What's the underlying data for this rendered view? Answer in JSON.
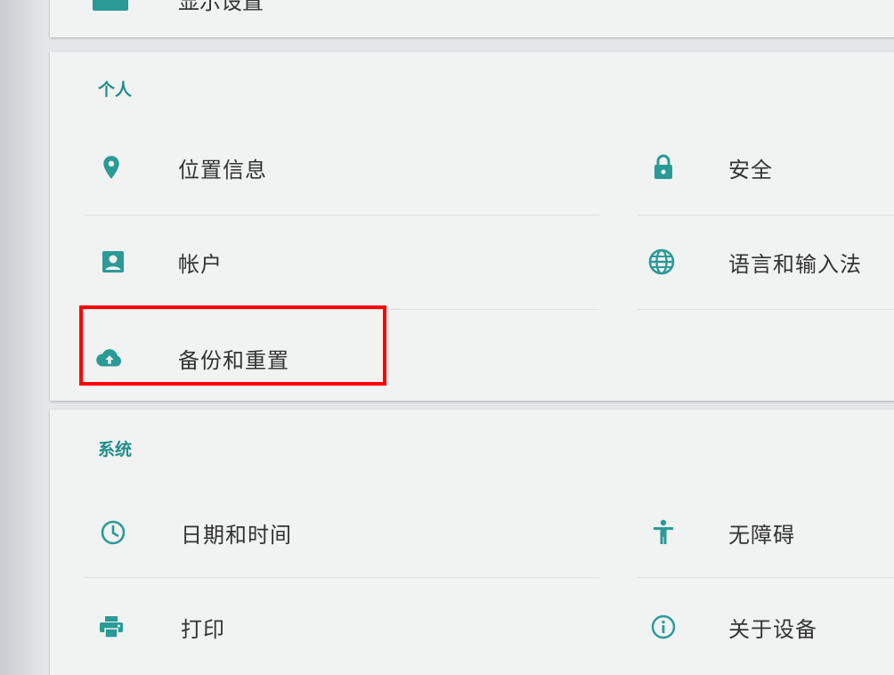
{
  "top_card": {
    "partial_label": "显示设置"
  },
  "personal": {
    "header": "个人",
    "items": [
      {
        "label": "位置信息",
        "icon": "location-pin-icon"
      },
      {
        "label": "安全",
        "icon": "lock-icon"
      },
      {
        "label": "帐户",
        "icon": "account-box-icon"
      },
      {
        "label": "语言和输入法",
        "icon": "globe-icon"
      },
      {
        "label": "备份和重置",
        "icon": "cloud-upload-icon"
      }
    ]
  },
  "system": {
    "header": "系统",
    "items": [
      {
        "label": "日期和时间",
        "icon": "clock-icon"
      },
      {
        "label": "无障碍",
        "icon": "accessibility-icon"
      },
      {
        "label": "打印",
        "icon": "printer-icon"
      },
      {
        "label": "关于设备",
        "icon": "info-icon"
      }
    ]
  },
  "colors": {
    "accent": "#2a9a97",
    "header": "#1f8e8a",
    "highlight": "#ff0000"
  }
}
